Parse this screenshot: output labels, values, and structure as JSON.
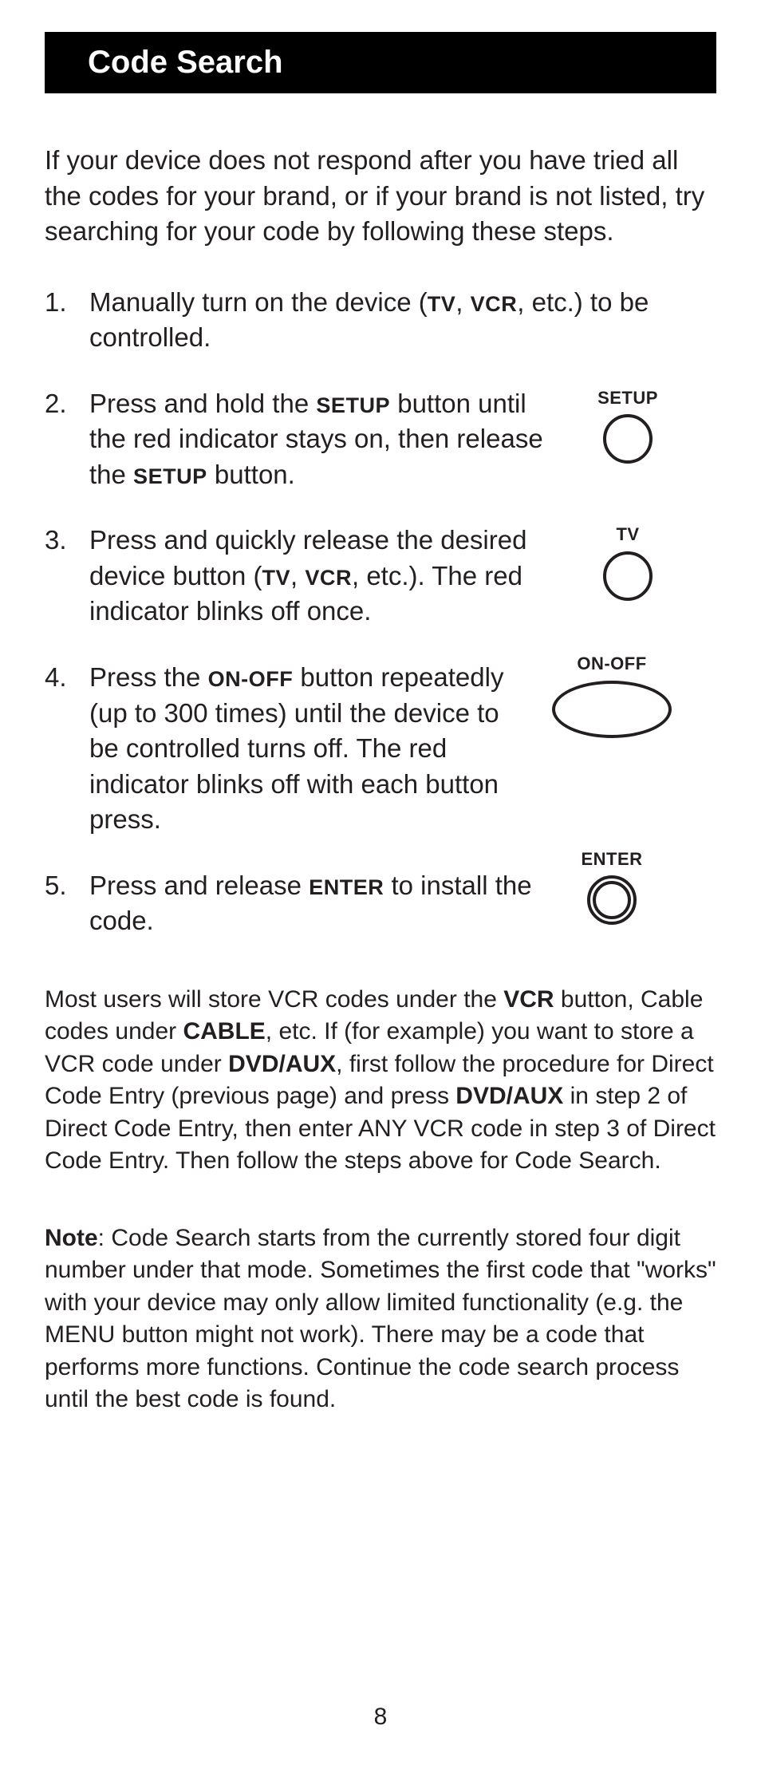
{
  "title": "Code Search",
  "intro": "If your device does not respond after you have tried all the codes for your brand, or if your brand is not listed, try searching for your code by following these steps.",
  "steps": {
    "s1_a": "Manually turn on the device (",
    "s1_tv": "TV",
    "s1_b": ", ",
    "s1_vcr": "VCR",
    "s1_c": ", etc.) to be controlled.",
    "s2_a": "Press and hold the ",
    "s2_setup1": "SETUP",
    "s2_b": " button until the red indicator stays on, then release the ",
    "s2_setup2": "SETUP",
    "s2_c": " button.",
    "s3_a": "Press and quickly release the desired device button (",
    "s3_tv": "TV",
    "s3_b": ", ",
    "s3_vcr": "VCR",
    "s3_c": ", etc.). The red indicator blinks off once.",
    "s4_a": "Press the ",
    "s4_onoff": "ON-OFF",
    "s4_b": " button repeatedly (up to 300 times) until the device to be controlled turns off. The red indicator blinks off with each button press.",
    "s5_a": "Press and release ",
    "s5_enter": "ENTER",
    "s5_b": " to install the code."
  },
  "labels": {
    "setup": "SETUP",
    "tv": "TV",
    "onoff": "ON-OFF",
    "enter": "ENTER"
  },
  "p1_a": "Most users will store VCR codes under the ",
  "p1_vcr": "VCR",
  "p1_b": " button, Cable codes under ",
  "p1_cable": "CABLE",
  "p1_c": ", etc. If (for example) you want to store a VCR code under ",
  "p1_dvdaux1": "DVD/AUX",
  "p1_d": ", first follow the procedure for Direct Code Entry (previous page) and press ",
  "p1_dvdaux2": "DVD/AUX",
  "p1_e": " in step 2 of Direct Code Entry, then enter ANY VCR code in step 3 of Direct Code Entry. Then follow the steps above for Code Search.",
  "p2_note": "Note",
  "p2_body": ":  Code Search starts from the currently stored four digit number under that mode. Sometimes the first code that \"works\" with your device may only allow limited functionality (e.g. the MENU button might not work). There may be a code that performs more functions. Continue the code search process until the best code is found.",
  "page_number": "8"
}
